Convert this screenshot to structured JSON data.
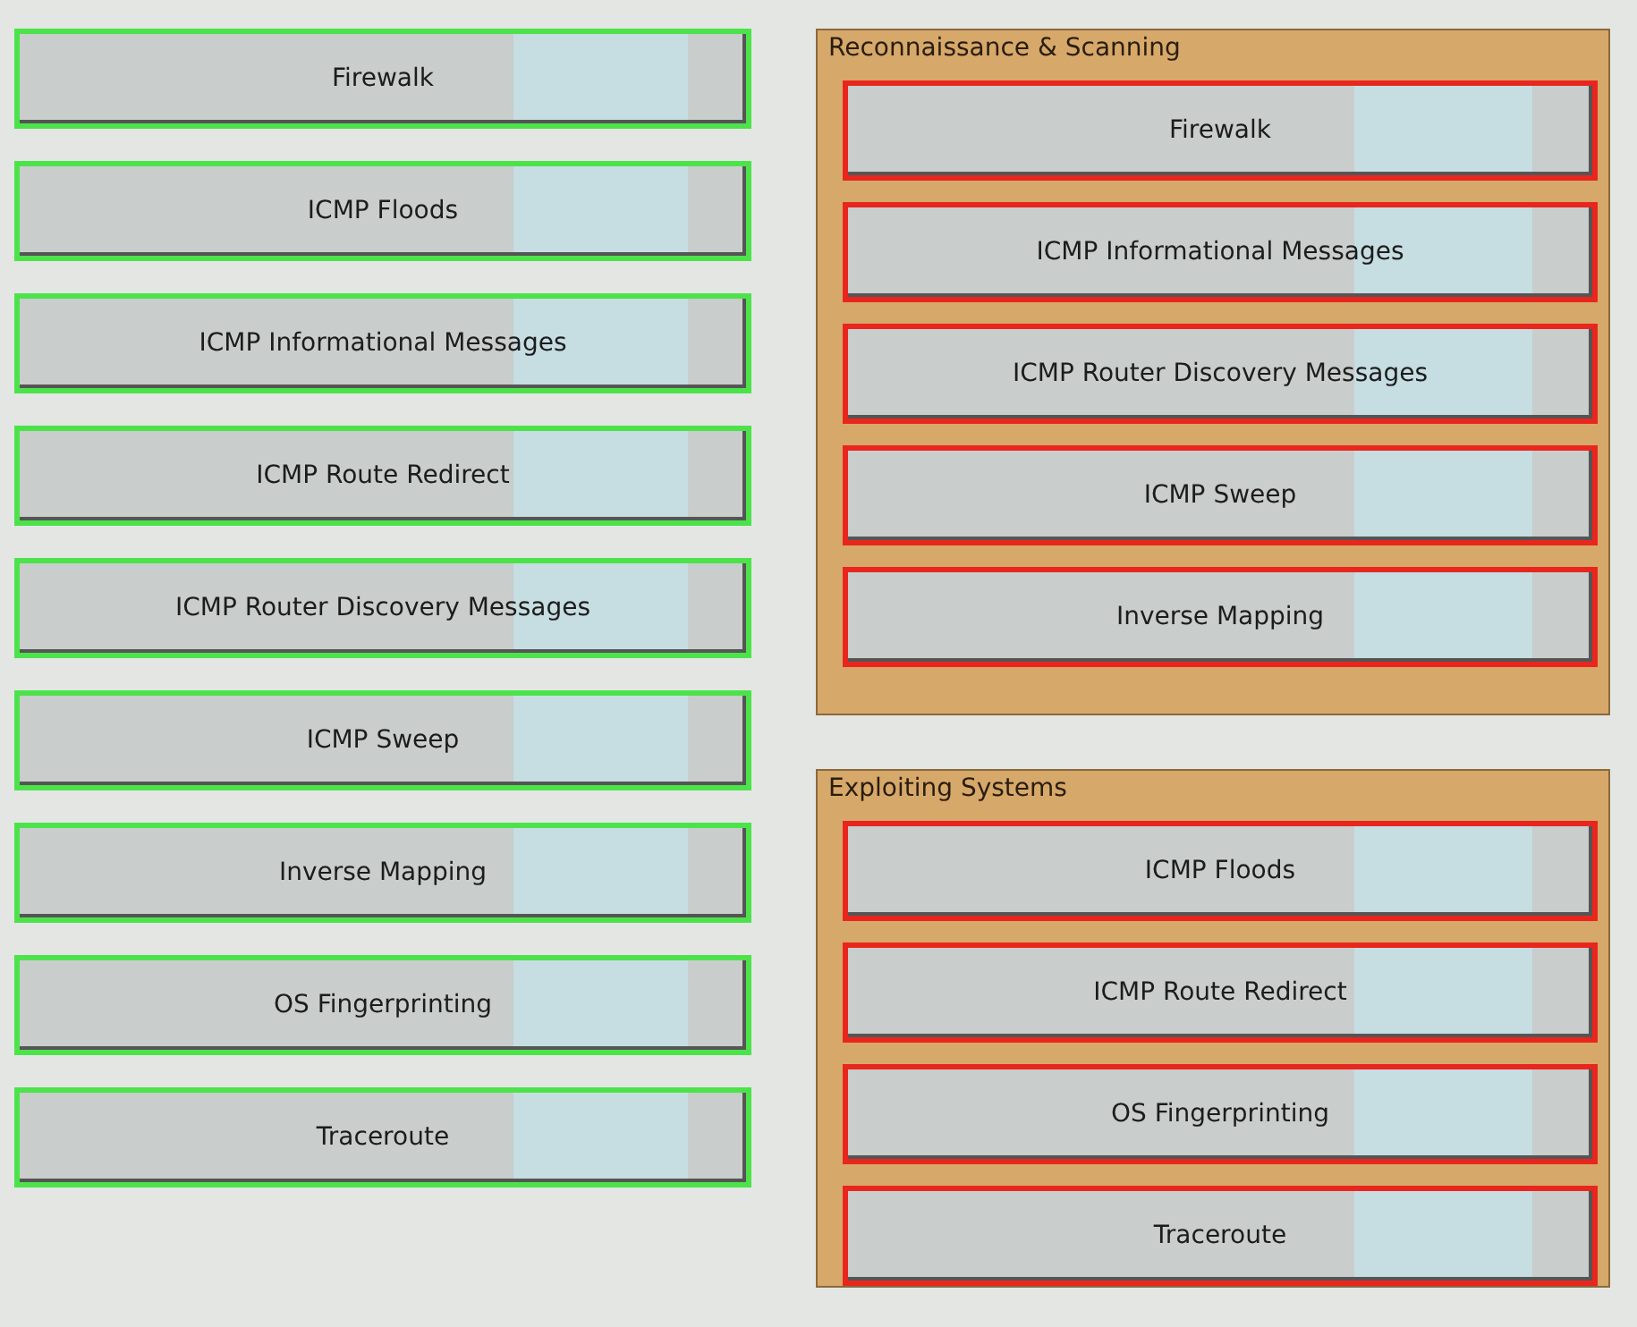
{
  "options": [
    "Firewalk",
    "ICMP Floods",
    "ICMP Informational Messages",
    "ICMP Route Redirect",
    "ICMP Router Discovery Messages",
    "ICMP Sweep",
    "Inverse Mapping",
    "OS Fingerprinting",
    "Traceroute"
  ],
  "categories": [
    {
      "title": "Reconnaissance & Scanning",
      "items": [
        "Firewalk",
        "ICMP Informational Messages",
        "ICMP Router Discovery Messages",
        "ICMP Sweep",
        "Inverse Mapping"
      ]
    },
    {
      "title": "Exploiting Systems",
      "items": [
        "ICMP Floods",
        "ICMP Route Redirect",
        "OS Fingerprinting",
        "Traceroute"
      ]
    }
  ]
}
